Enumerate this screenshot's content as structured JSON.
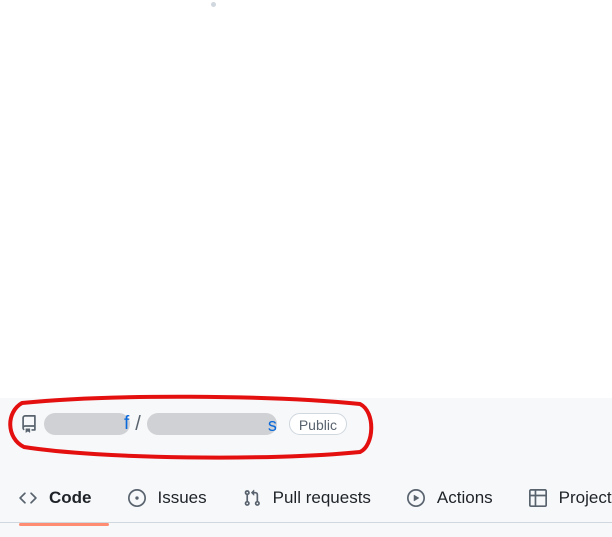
{
  "repo_header": {
    "owner_visible_suffix": "f",
    "separator": "/",
    "repo_visible_suffix": "s",
    "visibility_badge": "Public"
  },
  "tabs": [
    {
      "label": "Code",
      "icon": "code-icon",
      "active": true
    },
    {
      "label": "Issues",
      "icon": "issue-opened-icon",
      "active": false
    },
    {
      "label": "Pull requests",
      "icon": "git-pull-request-icon",
      "active": false
    },
    {
      "label": "Actions",
      "icon": "play-icon",
      "active": false
    },
    {
      "label": "Projects",
      "icon": "table-icon",
      "active": false
    }
  ],
  "colors": {
    "link": "#0969da",
    "active_tab_underline": "#fd8c73",
    "annotation": "#e41010",
    "header_bg": "#f6f8fa"
  }
}
